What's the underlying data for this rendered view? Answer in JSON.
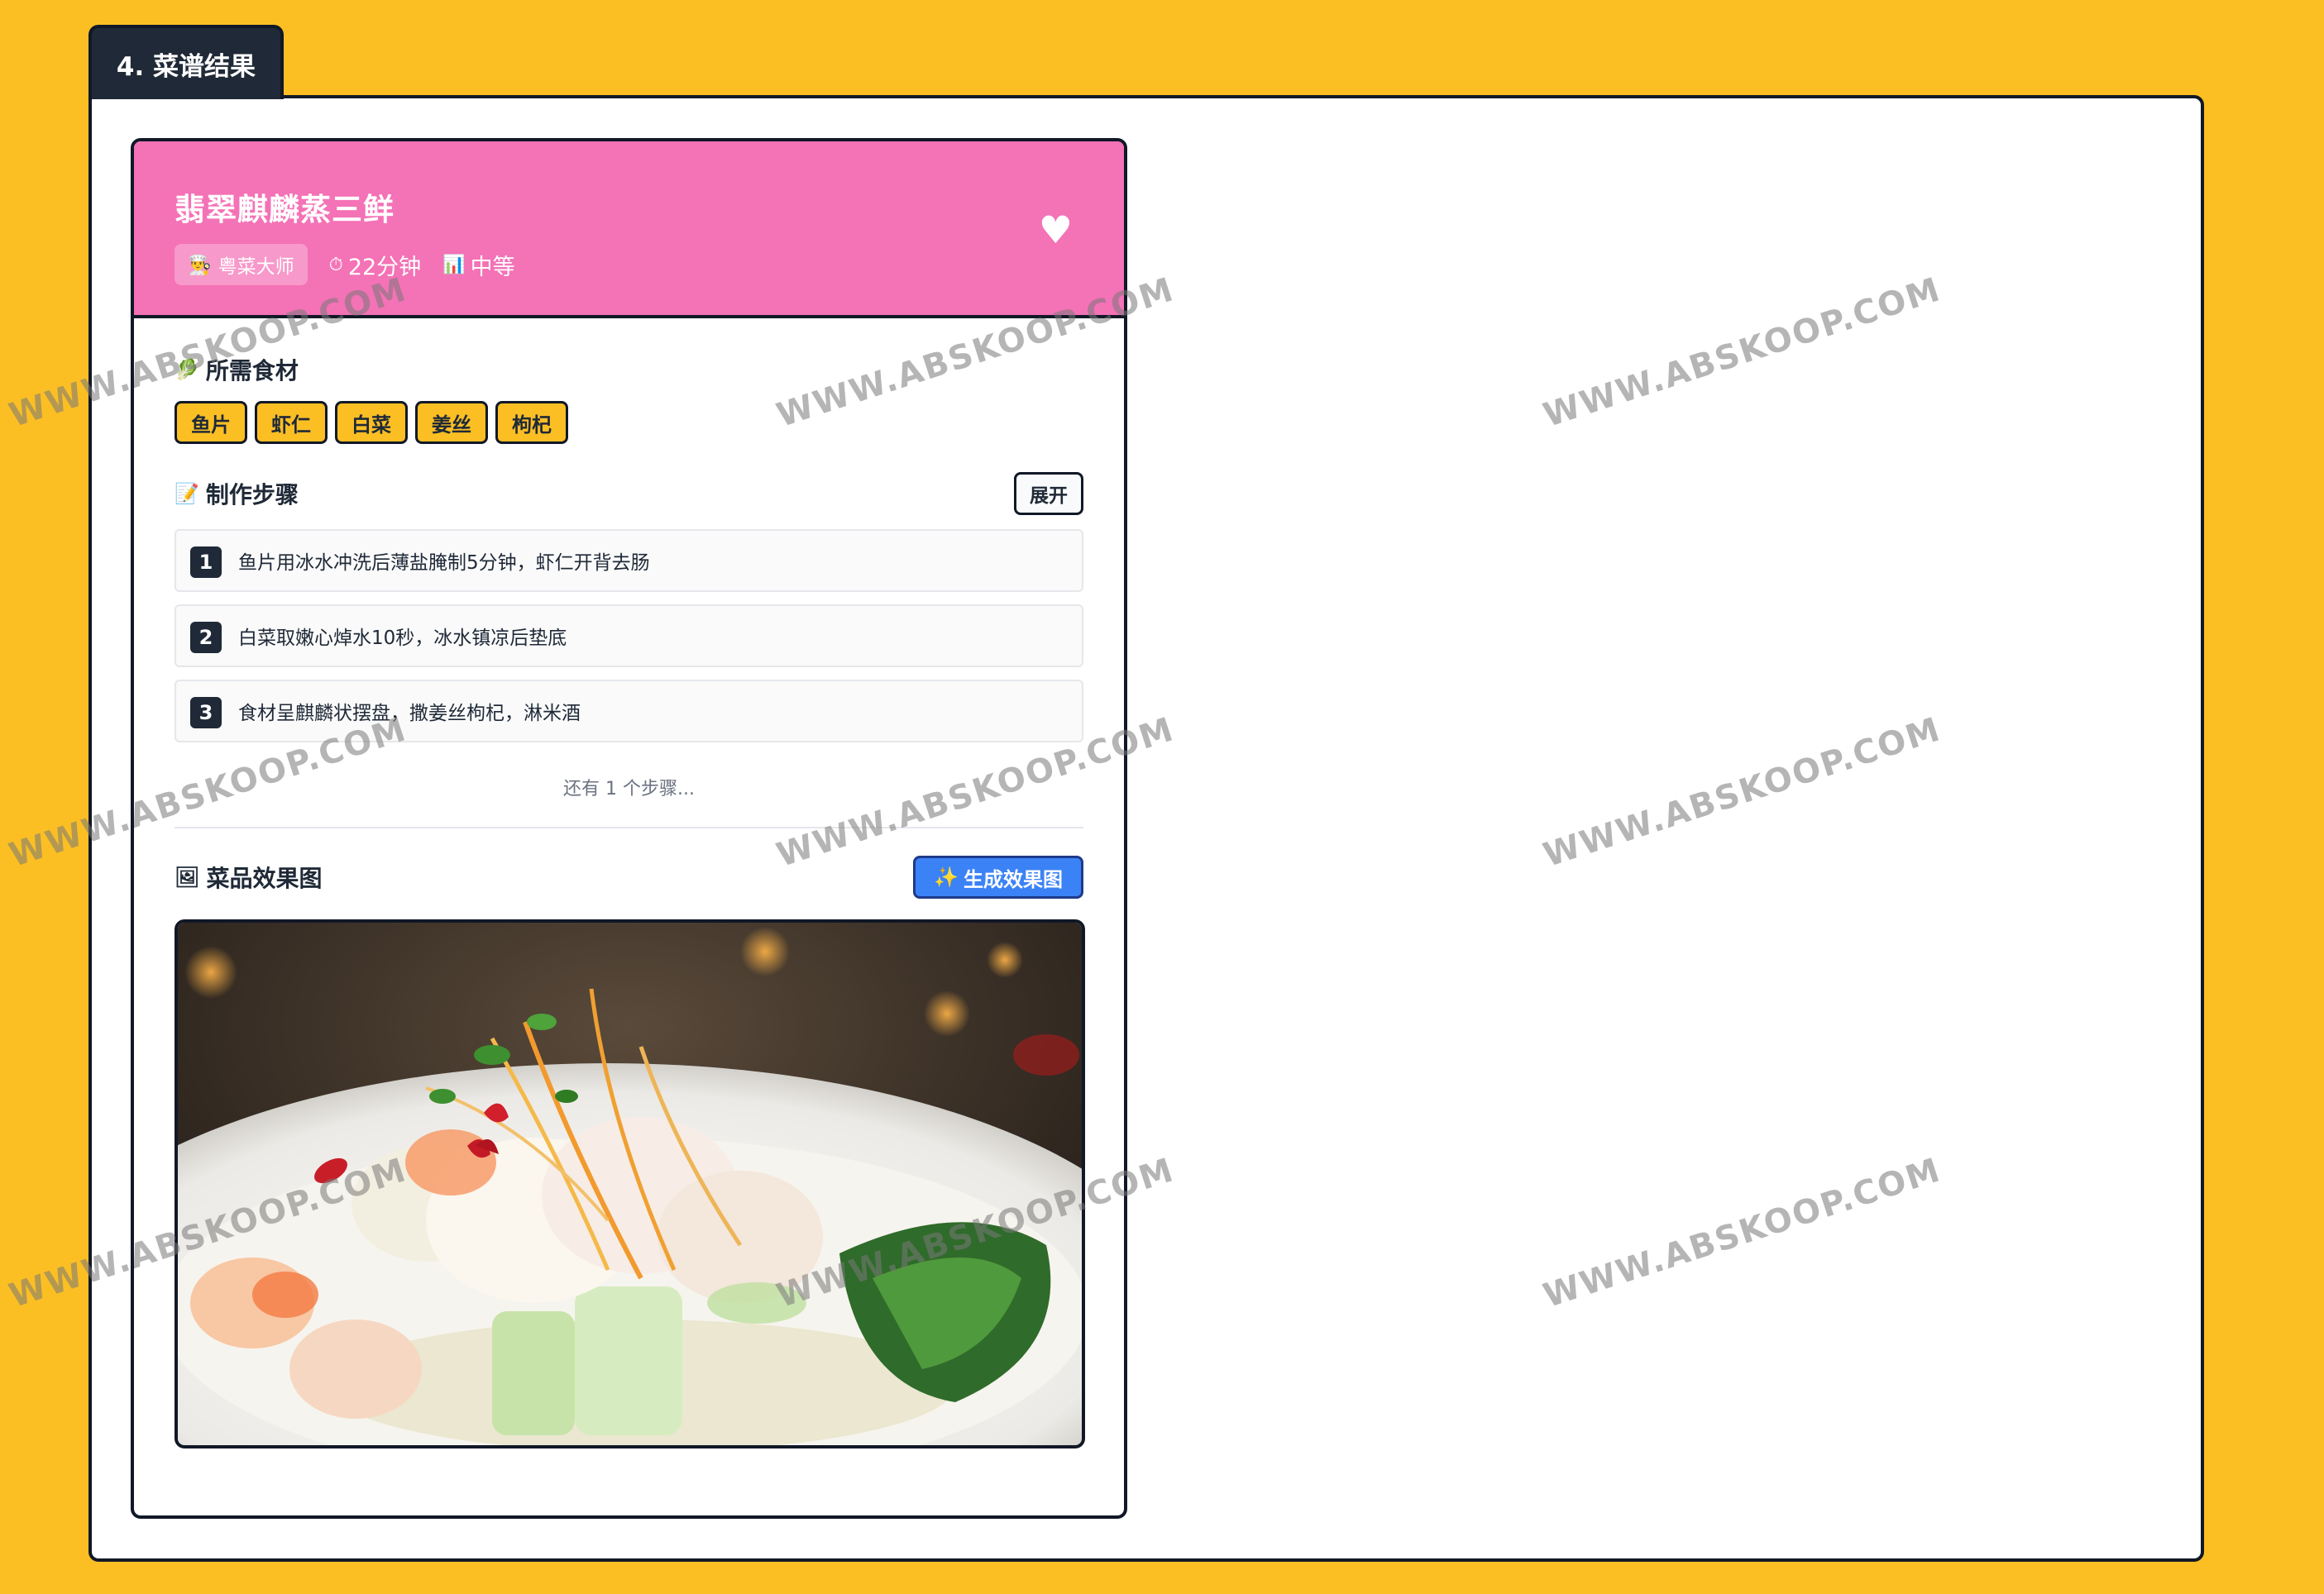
{
  "section": {
    "label": "4. 菜谱结果"
  },
  "recipe": {
    "title": "翡翠麒麟蒸三鲜",
    "chef": {
      "icon": "chef-icon",
      "label": "粤菜大师"
    },
    "time": {
      "icon": "stopwatch-icon",
      "label": "22分钟"
    },
    "difficulty": {
      "icon": "bar-chart-icon",
      "label": "中等"
    },
    "favorite_icon": "heart-icon"
  },
  "ingredients": {
    "title": "所需食材",
    "icon": "leaf-icon",
    "items": [
      "鱼片",
      "虾仁",
      "白菜",
      "姜丝",
      "枸杞"
    ]
  },
  "steps": {
    "title": "制作步骤",
    "icon": "memo-icon",
    "expand_label": "展开",
    "items": [
      {
        "num": "1",
        "text": "鱼片用冰水冲洗后薄盐腌制5分钟，虾仁开背去肠"
      },
      {
        "num": "2",
        "text": "白菜取嫩心焯水10秒，冰水镇凉后垫底"
      },
      {
        "num": "3",
        "text": "食材呈麒麟状摆盘，撒姜丝枸杞，淋米酒"
      }
    ],
    "more_label": "还有 1 个步骤..."
  },
  "dish_image": {
    "title": "菜品效果图",
    "icon": "picture-icon",
    "generate_label": "生成效果图",
    "generate_icon": "sparkles-icon"
  },
  "watermark": "WWW.ABSKOOP.COM",
  "colors": {
    "background": "#FBBF24",
    "header": "#F472B6",
    "dark": "#1f2937",
    "button_blue": "#3B82F6"
  }
}
